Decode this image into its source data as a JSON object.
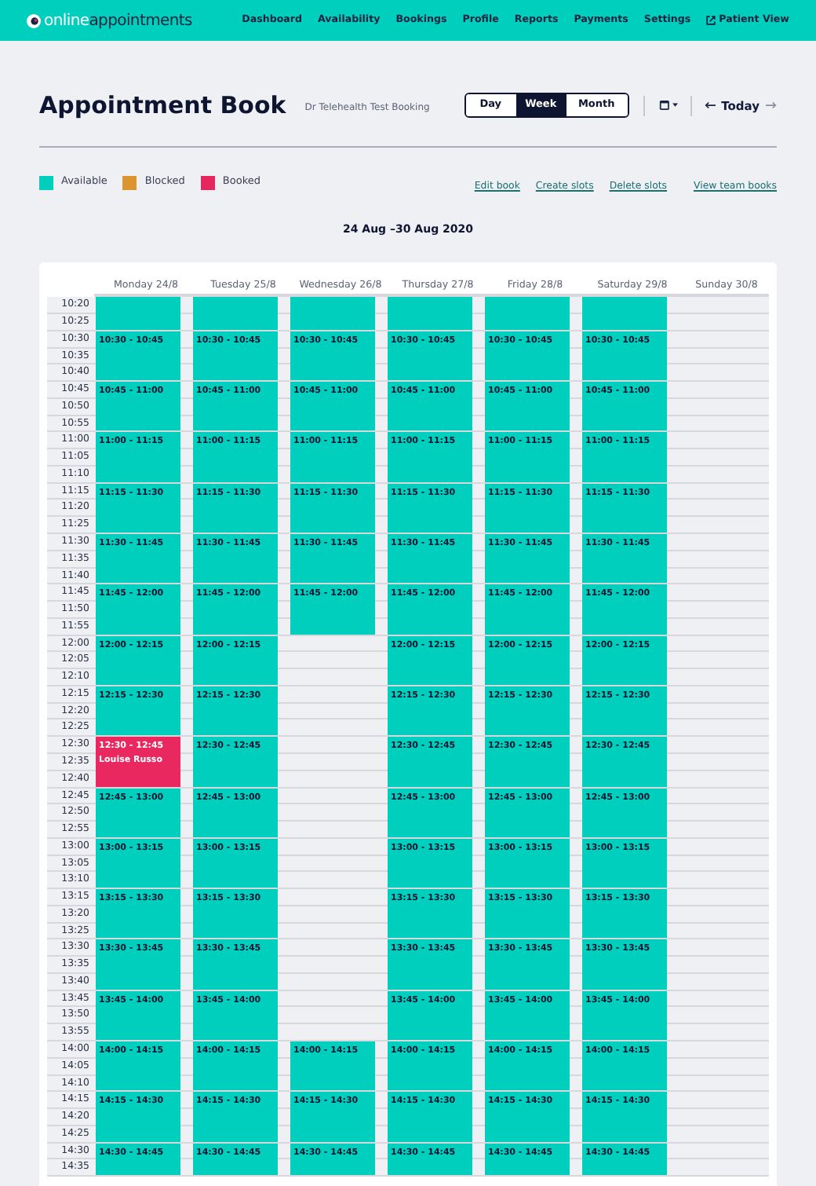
{
  "brand": {
    "part_1": "online",
    "part_2": "appointments"
  },
  "nav": [
    {
      "label": "Dashboard",
      "kind": "plain"
    },
    {
      "label": "Availability",
      "kind": "plain"
    },
    {
      "label": "Bookings",
      "kind": "plain"
    },
    {
      "label": "Profile",
      "kind": "plain"
    },
    {
      "label": "Reports",
      "kind": "plain"
    },
    {
      "label": "Payments",
      "kind": "plain"
    },
    {
      "label": "Settings",
      "kind": "plain"
    },
    {
      "label": "Patient View",
      "kind": "external"
    }
  ],
  "page": {
    "title": "Appointment Book",
    "subtitle": "Dr Telehealth Test Booking"
  },
  "views": [
    {
      "label": "Day",
      "selected": false
    },
    {
      "label": "Week",
      "selected": true
    },
    {
      "label": "Month",
      "selected": false
    }
  ],
  "today": "Today",
  "legend": [
    {
      "label": "Available",
      "color": "#00cfbd"
    },
    {
      "label": "Blocked",
      "color": "#dc9430"
    },
    {
      "label": "Booked",
      "color": "#e6265f"
    }
  ],
  "links": [
    "Edit book",
    "Create slots",
    "Delete slots",
    "View team books"
  ],
  "range": "24 Aug –30 Aug 2020",
  "times": [
    "10:20",
    "10:25",
    "10:30",
    "10:35",
    "10:40",
    "10:45",
    "10:50",
    "10:55",
    "11:00",
    "11:05",
    "11:10",
    "11:15",
    "11:20",
    "11:25",
    "11:30",
    "11:35",
    "11:40",
    "11:45",
    "11:50",
    "11:55",
    "12:00",
    "12:05",
    "12:10",
    "12:15",
    "12:20",
    "12:25",
    "12:30",
    "12:35",
    "12:40",
    "12:45",
    "12:50",
    "12:55",
    "13:00",
    "13:05",
    "13:10",
    "13:15",
    "13:20",
    "13:25",
    "13:30",
    "13:35",
    "13:40",
    "13:45",
    "13:50",
    "13:55",
    "14:00",
    "14:05",
    "14:10",
    "14:15",
    "14:20",
    "14:25",
    "14:30",
    "14:35"
  ],
  "days": [
    {
      "label": "Monday 24/8",
      "slots": [
        {
          "kind": "available"
        },
        {
          "kind": "available",
          "label": "10:30 - 10:45"
        },
        {
          "kind": "available",
          "label": "10:45 - 11:00"
        },
        {
          "kind": "available",
          "label": "11:00 - 11:15"
        },
        {
          "kind": "available",
          "label": "11:15 - 11:30"
        },
        {
          "kind": "available",
          "label": "11:30 - 11:45"
        },
        {
          "kind": "available",
          "label": "11:45 - 12:00"
        },
        {
          "kind": "available",
          "label": "12:00 - 12:15"
        },
        {
          "kind": "available",
          "label": "12:15 - 12:30"
        },
        {
          "kind": "booked",
          "label": "12:30 - 12:45",
          "name": "Louise Russo"
        },
        {
          "kind": "available",
          "label": "12:45 - 13:00"
        },
        {
          "kind": "available",
          "label": "13:00 - 13:15"
        },
        {
          "kind": "available",
          "label": "13:15 - 13:30"
        },
        {
          "kind": "available",
          "label": "13:30 - 13:45"
        },
        {
          "kind": "available",
          "label": "13:45 - 14:00"
        },
        {
          "kind": "available",
          "label": "14:00 - 14:15"
        },
        {
          "kind": "available",
          "label": "14:15 - 14:30"
        },
        {
          "kind": "available",
          "label": "14:30 - 14:45"
        }
      ]
    },
    {
      "label": "Tuesday 25/8",
      "slots": [
        {
          "kind": "available"
        },
        {
          "kind": "available",
          "label": "10:30 - 10:45"
        },
        {
          "kind": "available",
          "label": "10:45 - 11:00"
        },
        {
          "kind": "available",
          "label": "11:00 - 11:15"
        },
        {
          "kind": "available",
          "label": "11:15 - 11:30"
        },
        {
          "kind": "available",
          "label": "11:30 - 11:45"
        },
        {
          "kind": "available",
          "label": "11:45 - 12:00"
        },
        {
          "kind": "available",
          "label": "12:00 - 12:15"
        },
        {
          "kind": "available",
          "label": "12:15 - 12:30"
        },
        {
          "kind": "available",
          "label": "12:30 - 12:45"
        },
        {
          "kind": "available",
          "label": "12:45 - 13:00"
        },
        {
          "kind": "available",
          "label": "13:00 - 13:15"
        },
        {
          "kind": "available",
          "label": "13:15 - 13:30"
        },
        {
          "kind": "available",
          "label": "13:30 - 13:45"
        },
        {
          "kind": "available",
          "label": "13:45 - 14:00"
        },
        {
          "kind": "available",
          "label": "14:00 - 14:15"
        },
        {
          "kind": "available",
          "label": "14:15 - 14:30"
        },
        {
          "kind": "available",
          "label": "14:30 - 14:45"
        }
      ]
    },
    {
      "label": "Wednesday 26/8",
      "slots": [
        {
          "kind": "available"
        },
        {
          "kind": "available",
          "label": "10:30 - 10:45"
        },
        {
          "kind": "available",
          "label": "10:45 - 11:00"
        },
        {
          "kind": "available",
          "label": "11:00 - 11:15"
        },
        {
          "kind": "available",
          "label": "11:15 - 11:30"
        },
        {
          "kind": "available",
          "label": "11:30 - 11:45"
        },
        {
          "kind": "available",
          "label": "11:45 - 12:00"
        },
        {
          "kind": "gap"
        },
        {
          "kind": "gap"
        },
        {
          "kind": "gap"
        },
        {
          "kind": "gap"
        },
        {
          "kind": "gap"
        },
        {
          "kind": "gap"
        },
        {
          "kind": "gap"
        },
        {
          "kind": "gap"
        },
        {
          "kind": "available",
          "label": "14:00 - 14:15"
        },
        {
          "kind": "available",
          "label": "14:15 - 14:30"
        },
        {
          "kind": "available",
          "label": "14:30 - 14:45"
        }
      ]
    },
    {
      "label": "Thursday 27/8",
      "slots": [
        {
          "kind": "available"
        },
        {
          "kind": "available",
          "label": "10:30 - 10:45"
        },
        {
          "kind": "available",
          "label": "10:45 - 11:00"
        },
        {
          "kind": "available",
          "label": "11:00 - 11:15"
        },
        {
          "kind": "available",
          "label": "11:15 - 11:30"
        },
        {
          "kind": "available",
          "label": "11:30 - 11:45"
        },
        {
          "kind": "available",
          "label": "11:45 - 12:00"
        },
        {
          "kind": "available",
          "label": "12:00 - 12:15"
        },
        {
          "kind": "available",
          "label": "12:15 - 12:30"
        },
        {
          "kind": "available",
          "label": "12:30 - 12:45"
        },
        {
          "kind": "available",
          "label": "12:45 - 13:00"
        },
        {
          "kind": "available",
          "label": "13:00 - 13:15"
        },
        {
          "kind": "available",
          "label": "13:15 - 13:30"
        },
        {
          "kind": "available",
          "label": "13:30 - 13:45"
        },
        {
          "kind": "available",
          "label": "13:45 - 14:00"
        },
        {
          "kind": "available",
          "label": "14:00 - 14:15"
        },
        {
          "kind": "available",
          "label": "14:15 - 14:30"
        },
        {
          "kind": "available",
          "label": "14:30 - 14:45"
        }
      ]
    },
    {
      "label": "Friday 28/8",
      "slots": [
        {
          "kind": "available"
        },
        {
          "kind": "available",
          "label": "10:30 - 10:45"
        },
        {
          "kind": "available",
          "label": "10:45 - 11:00"
        },
        {
          "kind": "available",
          "label": "11:00 - 11:15"
        },
        {
          "kind": "available",
          "label": "11:15 - 11:30"
        },
        {
          "kind": "available",
          "label": "11:30 - 11:45"
        },
        {
          "kind": "available",
          "label": "11:45 - 12:00"
        },
        {
          "kind": "available",
          "label": "12:00 - 12:15"
        },
        {
          "kind": "available",
          "label": "12:15 - 12:30"
        },
        {
          "kind": "available",
          "label": "12:30 - 12:45"
        },
        {
          "kind": "available",
          "label": "12:45 - 13:00"
        },
        {
          "kind": "available",
          "label": "13:00 - 13:15"
        },
        {
          "kind": "available",
          "label": "13:15 - 13:30"
        },
        {
          "kind": "available",
          "label": "13:30 - 13:45"
        },
        {
          "kind": "available",
          "label": "13:45 - 14:00"
        },
        {
          "kind": "available",
          "label": "14:00 - 14:15"
        },
        {
          "kind": "available",
          "label": "14:15 - 14:30"
        },
        {
          "kind": "available",
          "label": "14:30 - 14:45"
        }
      ]
    },
    {
      "label": "Saturday 29/8",
      "slots": [
        {
          "kind": "available"
        },
        {
          "kind": "available",
          "label": "10:30 - 10:45"
        },
        {
          "kind": "available",
          "label": "10:45 - 11:00"
        },
        {
          "kind": "available",
          "label": "11:00 - 11:15"
        },
        {
          "kind": "available",
          "label": "11:15 - 11:30"
        },
        {
          "kind": "available",
          "label": "11:30 - 11:45"
        },
        {
          "kind": "available",
          "label": "11:45 - 12:00"
        },
        {
          "kind": "available",
          "label": "12:00 - 12:15"
        },
        {
          "kind": "available",
          "label": "12:15 - 12:30"
        },
        {
          "kind": "available",
          "label": "12:30 - 12:45"
        },
        {
          "kind": "available",
          "label": "12:45 - 13:00"
        },
        {
          "kind": "available",
          "label": "13:00 - 13:15"
        },
        {
          "kind": "available",
          "label": "13:15 - 13:30"
        },
        {
          "kind": "available",
          "label": "13:30 - 13:45"
        },
        {
          "kind": "available",
          "label": "13:45 - 14:00"
        },
        {
          "kind": "available",
          "label": "14:00 - 14:15"
        },
        {
          "kind": "available",
          "label": "14:15 - 14:30"
        },
        {
          "kind": "available",
          "label": "14:30 - 14:45"
        }
      ]
    },
    {
      "label": "Sunday 30/8"
    }
  ]
}
